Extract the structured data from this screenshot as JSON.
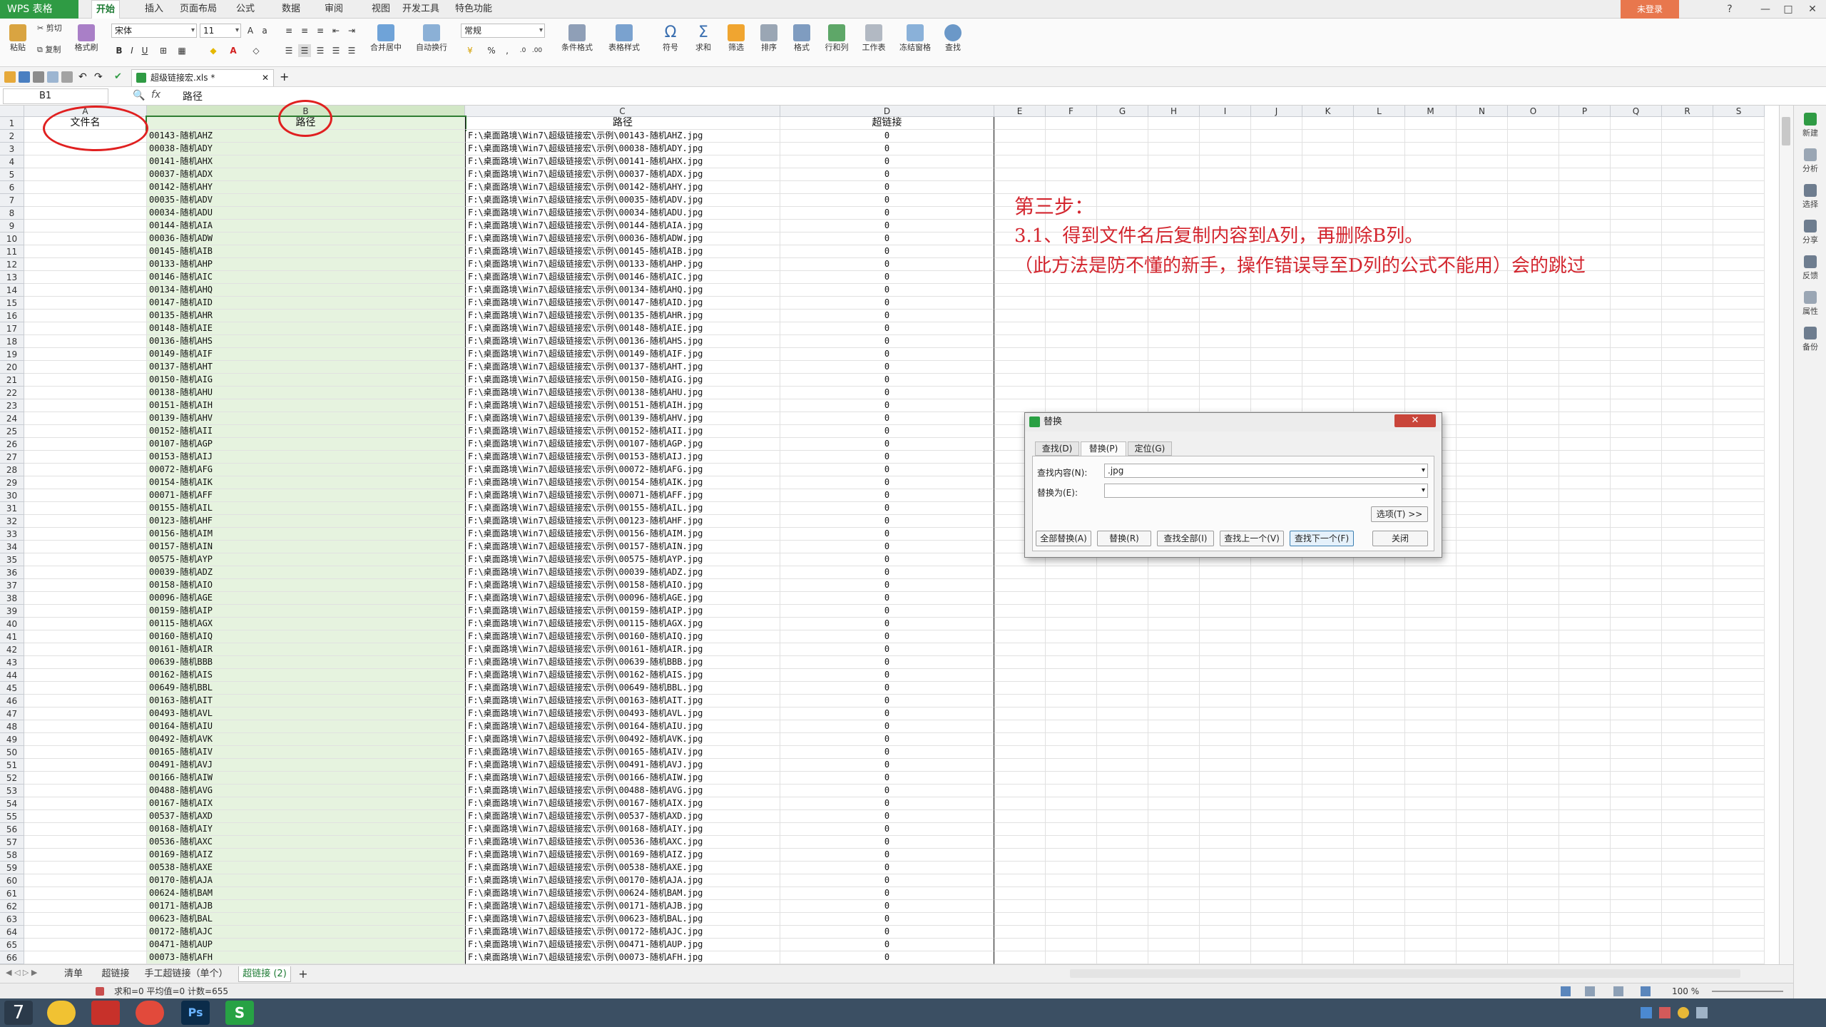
{
  "app": {
    "menu_button": "WPS 表格",
    "tabs": [
      "开始",
      "插入",
      "页面布局",
      "公式",
      "数据",
      "审阅",
      "视图",
      "开发工具",
      "特色功能"
    ],
    "login": "未登录",
    "window_buttons": [
      "?",
      "—",
      "□",
      "✕"
    ]
  },
  "ribbon": {
    "paste": "粘贴",
    "cut": "剪切",
    "copy": "复制",
    "format_painter": "格式刷",
    "font_name": "宋体",
    "font_size": "11",
    "bold": "B",
    "italic": "I",
    "underline": "U",
    "merge_center": "合并居中",
    "wrap_text": "自动换行",
    "number_format": "常规",
    "percent": "%",
    "cond_format": "条件格式",
    "table_style": "表格样式",
    "symbol": "符号",
    "sum": "求和",
    "filter": "筛选",
    "sort": "排序",
    "format": "格式",
    "rows_cols": "行和列",
    "worksheet": "工作表",
    "freeze": "冻结窗格",
    "find": "查找"
  },
  "doc_tab": {
    "label": "超级链接宏.xls *",
    "add": "+"
  },
  "formula_bar": {
    "name_box": "B1",
    "fx": "fx",
    "content": "路径"
  },
  "sheet": {
    "columns": [
      "A",
      "B",
      "C",
      "D",
      "E",
      "F",
      "G",
      "H",
      "I",
      "J",
      "K",
      "L",
      "M",
      "N",
      "O",
      "P",
      "Q",
      "R",
      "S"
    ],
    "header_row": {
      "a": "文件名",
      "b": "路径",
      "c": "路径",
      "d": "超链接"
    },
    "row_numbers": [
      "1",
      "2",
      "3",
      "4",
      "5",
      "6",
      "7",
      "8",
      "9",
      "10",
      "11",
      "12",
      "13",
      "14",
      "15",
      "16",
      "17",
      "18",
      "19",
      "20",
      "21",
      "22",
      "23",
      "24",
      "25",
      "26",
      "27",
      "28",
      "29",
      "30",
      "31",
      "32",
      "33",
      "34",
      "35",
      "36",
      "37",
      "38",
      "39",
      "40",
      "41",
      "42",
      "43",
      "44",
      "45",
      "46",
      "47",
      "48",
      "49",
      "50",
      "51",
      "52",
      "53",
      "54",
      "55",
      "56",
      "57",
      "58",
      "59",
      "60",
      "61",
      "62",
      "63",
      "64",
      "65",
      "66"
    ],
    "path_prefix": "F:\\桌面路境\\Win7\\超级链接宏\\示例\\",
    "ext": ".jpg",
    "hyperlink_value": "0",
    "items": [
      "00143-随机AHZ",
      "00038-随机ADY",
      "00141-随机AHX",
      "00037-随机ADX",
      "00142-随机AHY",
      "00035-随机ADV",
      "00034-随机ADU",
      "00144-随机AIA",
      "00036-随机ADW",
      "00145-随机AIB",
      "00133-随机AHP",
      "00146-随机AIC",
      "00134-随机AHQ",
      "00147-随机AID",
      "00135-随机AHR",
      "00148-随机AIE",
      "00136-随机AHS",
      "00149-随机AIF",
      "00137-随机AHT",
      "00150-随机AIG",
      "00138-随机AHU",
      "00151-随机AIH",
      "00139-随机AHV",
      "00152-随机AII",
      "00107-随机AGP",
      "00153-随机AIJ",
      "00072-随机AFG",
      "00154-随机AIK",
      "00071-随机AFF",
      "00155-随机AIL",
      "00123-随机AHF",
      "00156-随机AIM",
      "00157-随机AIN",
      "00575-随机AYP",
      "00039-随机ADZ",
      "00158-随机AIO",
      "00096-随机AGE",
      "00159-随机AIP",
      "00115-随机AGX",
      "00160-随机AIQ",
      "00161-随机AIR",
      "00639-随机BBB",
      "00162-随机AIS",
      "00649-随机BBL",
      "00163-随机AIT",
      "00493-随机AVL",
      "00164-随机AIU",
      "00492-随机AVK",
      "00165-随机AIV",
      "00491-随机AVJ",
      "00166-随机AIW",
      "00488-随机AVG",
      "00167-随机AIX",
      "00537-随机AXD",
      "00168-随机AIY",
      "00536-随机AXC",
      "00169-随机AIZ",
      "00538-随机AXE",
      "00170-随机AJA",
      "00624-随机BAM",
      "00171-随机AJB",
      "00623-随机BAL",
      "00172-随机AJC",
      "00471-随机AUP",
      "00073-随机AFH"
    ]
  },
  "annotation": {
    "line1": "第三步：",
    "line2": "3.1、得到文件名后复制内容到A列，再删除B列。",
    "line3": "（此方法是防不懂的新手，操作错误导至D列的公式不能用）会的跳过"
  },
  "dialog": {
    "title": "替换",
    "close": "✕",
    "tabs": [
      "查找(D)",
      "替换(P)",
      "定位(G)"
    ],
    "find_label": "查找内容(N):",
    "find_value": ".jpg",
    "replace_label": "替换为(E):",
    "replace_value": "",
    "options": "选项(T) >>",
    "buttons": [
      "全部替换(A)",
      "替换(R)",
      "查找全部(I)",
      "查找上一个(V)",
      "查找下一个(F)",
      "关闭"
    ]
  },
  "right_panel": [
    "新建",
    "分析",
    "选择",
    "分享",
    "反馈",
    "属性",
    "备份"
  ],
  "sheet_tabs": [
    "清单",
    "超链接",
    "手工超链接（单个）",
    "超链接 (2)"
  ],
  "sheet_tab_add": "+",
  "status": {
    "text": "求和=0  平均值=0  计数=655",
    "zoom": "100 %"
  },
  "colors": {
    "wps_green": "#2f9b44",
    "annotation_red": "#d3262f",
    "selection_green": "#e6f3df"
  }
}
